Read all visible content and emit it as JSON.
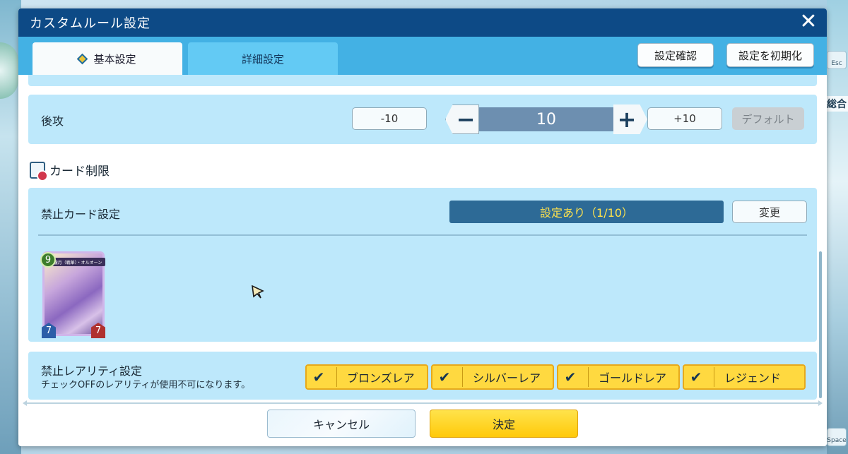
{
  "window": {
    "title": "カスタムルール設定",
    "close_icon": "close-icon"
  },
  "tabs": [
    {
      "label": "基本設定",
      "active": true
    },
    {
      "label": "詳細設定",
      "active": false
    }
  ],
  "header_buttons": {
    "confirm": "設定確認",
    "reset": "設定を初期化"
  },
  "second_player": {
    "label": "後攻",
    "minus10": "-10",
    "value": "10",
    "plus10": "+10",
    "default": "デフォルト"
  },
  "card_restriction": {
    "section_title": "カード制限",
    "banned_label": "禁止カード設定",
    "status": "設定あり（1/10）",
    "change_button": "変更",
    "card": {
      "cost": "9",
      "attack": "7",
      "defense": "7",
      "name_banner": "朧月（戦華）・オルオーン"
    }
  },
  "rarity": {
    "label": "禁止レアリティ設定",
    "note": "チェックOFFのレアリティが使用不可になります。",
    "options": [
      {
        "label": "ブロンズレア",
        "checked": true
      },
      {
        "label": "シルバーレア",
        "checked": true
      },
      {
        "label": "ゴールドレア",
        "checked": true
      },
      {
        "label": "レジェンド",
        "checked": true
      }
    ],
    "check_glyph": "✔"
  },
  "footer": {
    "cancel": "キャンセル",
    "ok": "決定"
  },
  "side": {
    "esc": "Esc",
    "space": "Space",
    "label": "総合"
  },
  "colors": {
    "title_bg": "#0d4a86",
    "tab_bar": "#43b1e4",
    "panel": "#bde8fb",
    "accent_yellow": "#ffd940"
  }
}
